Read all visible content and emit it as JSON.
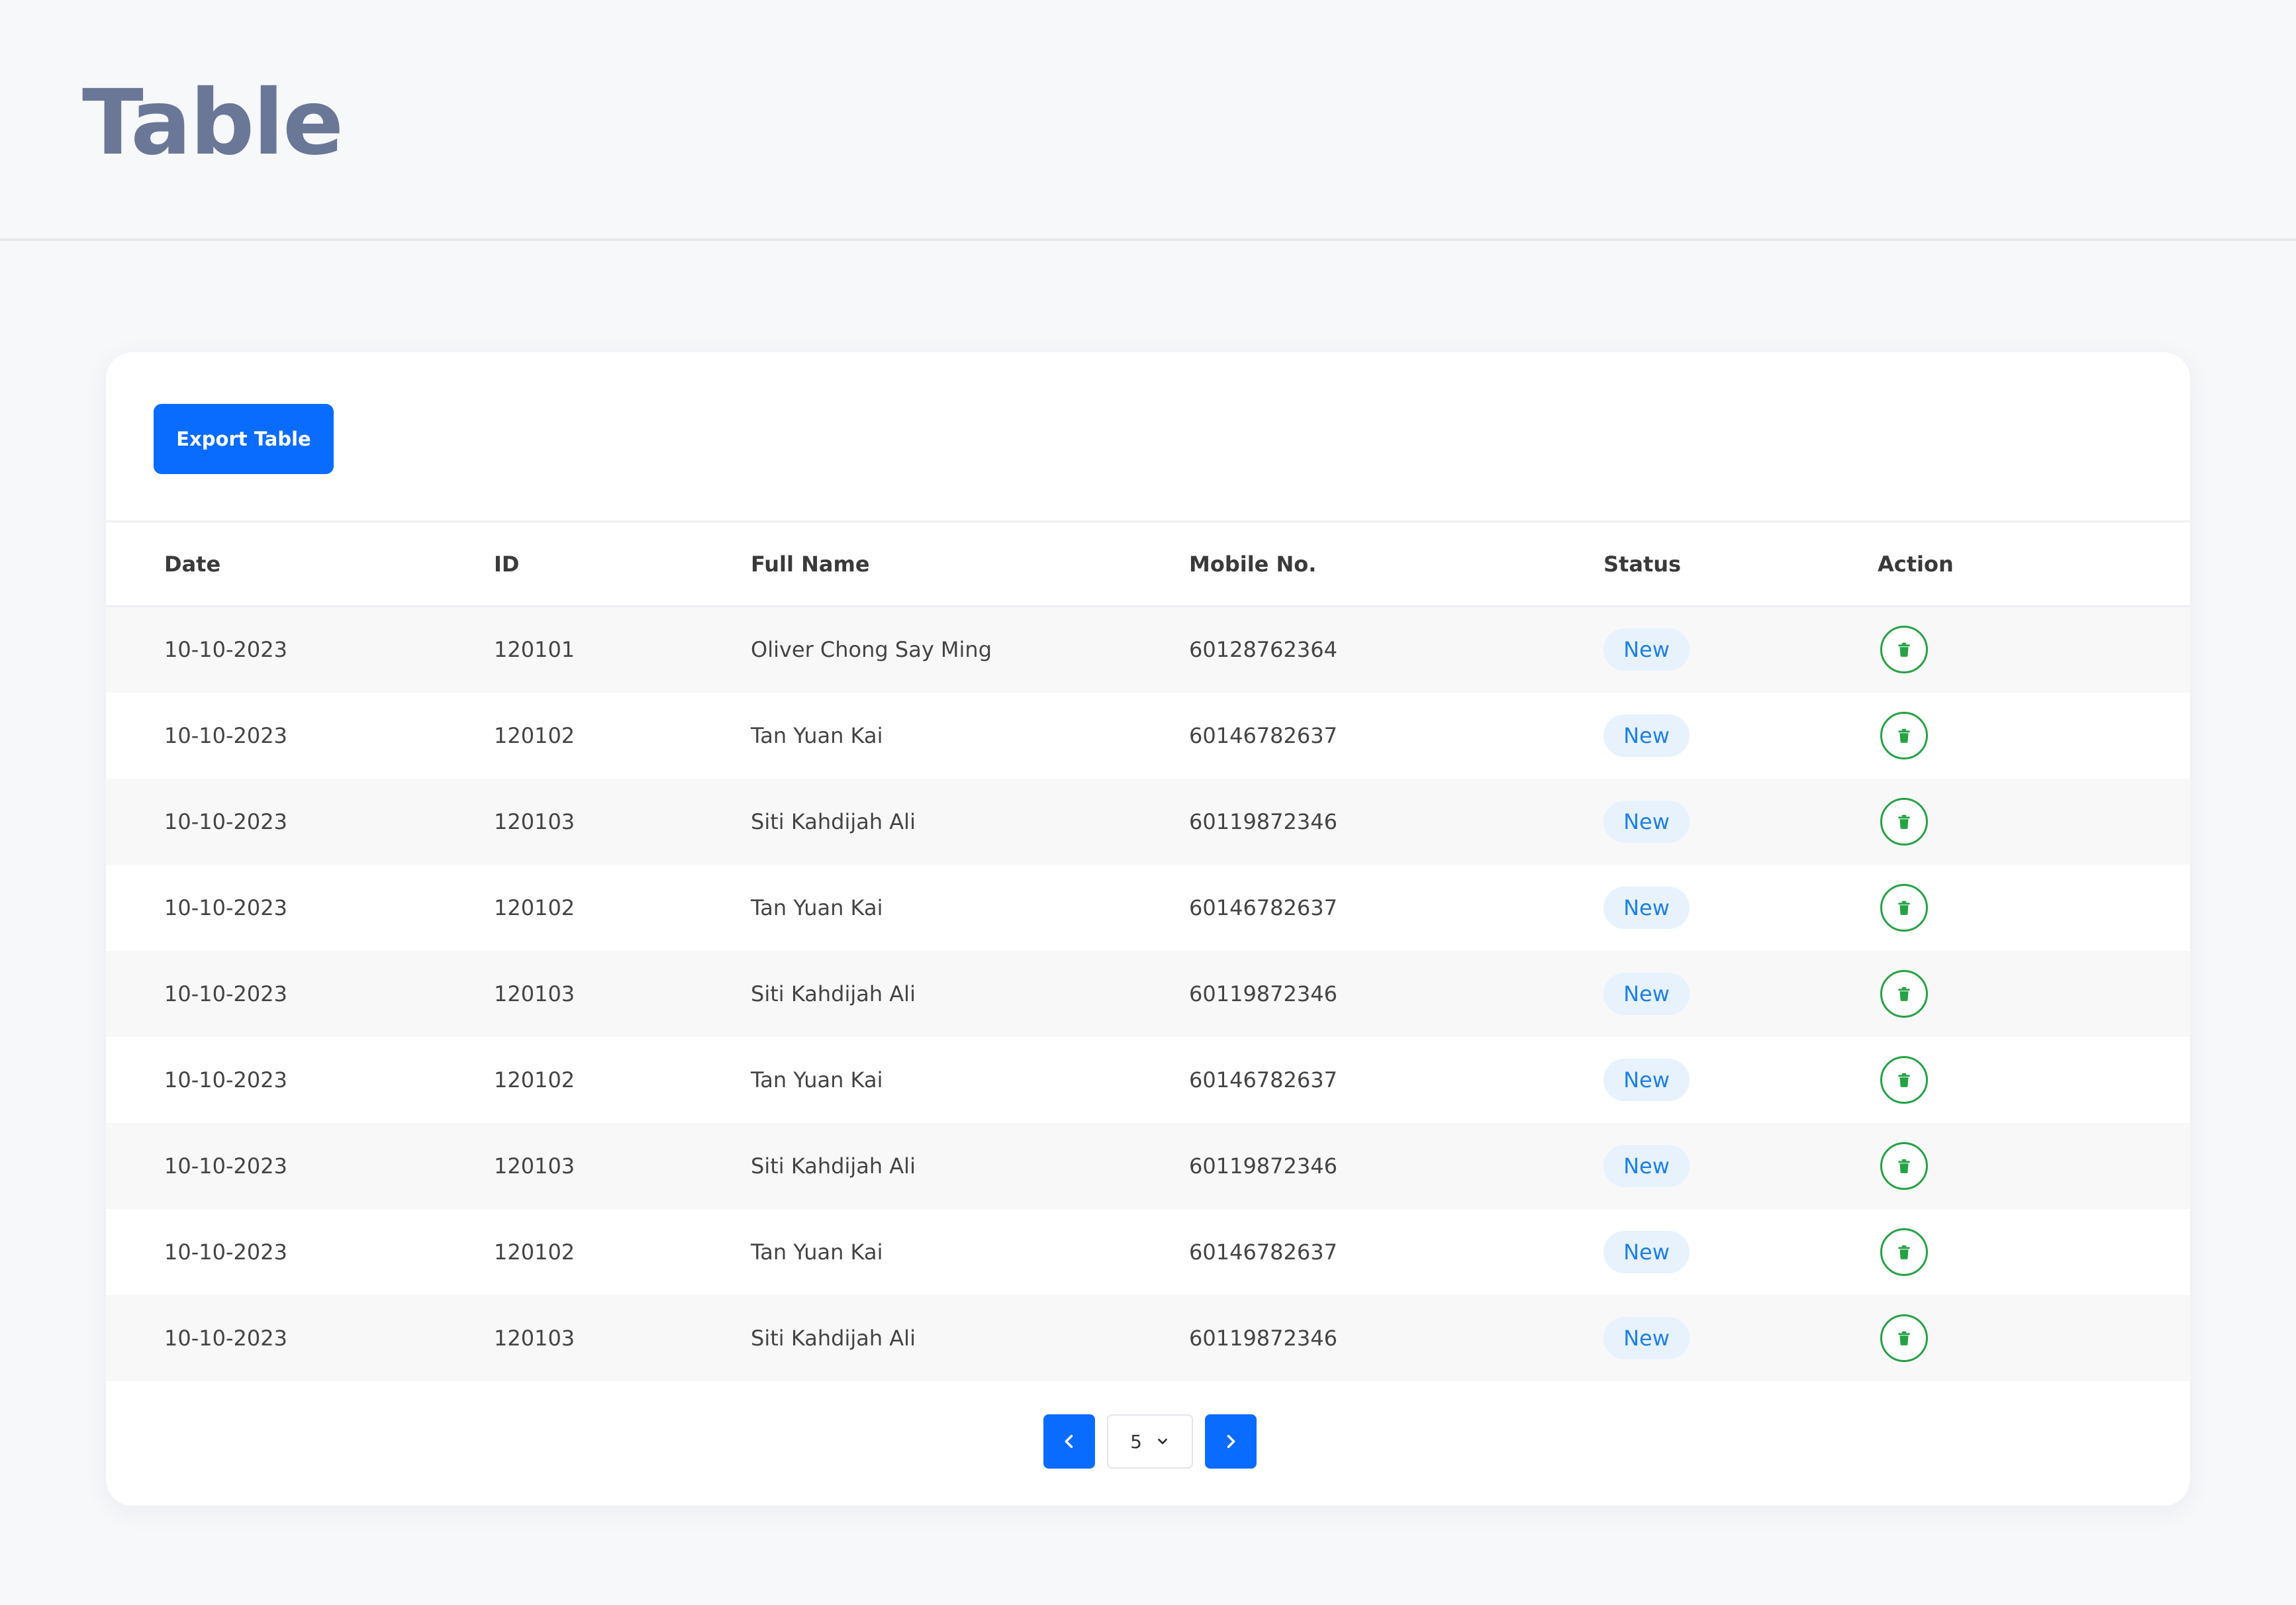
{
  "header": {
    "title": "Table"
  },
  "toolbar": {
    "export_label": "Export Table"
  },
  "table": {
    "columns": [
      "Date",
      "ID",
      "Full Name",
      "Mobile No.",
      "Status",
      "Action"
    ],
    "rows": [
      {
        "date": "10-10-2023",
        "id": "120101",
        "name": "Oliver Chong Say Ming",
        "mobile": "60128762364",
        "status": "New"
      },
      {
        "date": "10-10-2023",
        "id": "120102",
        "name": "Tan Yuan Kai",
        "mobile": "60146782637",
        "status": "New"
      },
      {
        "date": "10-10-2023",
        "id": "120103",
        "name": "Siti Kahdijah Ali",
        "mobile": "60119872346",
        "status": "New"
      },
      {
        "date": "10-10-2023",
        "id": "120102",
        "name": "Tan Yuan Kai",
        "mobile": "60146782637",
        "status": "New"
      },
      {
        "date": "10-10-2023",
        "id": "120103",
        "name": "Siti Kahdijah Ali",
        "mobile": "60119872346",
        "status": "New"
      },
      {
        "date": "10-10-2023",
        "id": "120102",
        "name": "Tan Yuan Kai",
        "mobile": "60146782637",
        "status": "New"
      },
      {
        "date": "10-10-2023",
        "id": "120103",
        "name": "Siti Kahdijah Ali",
        "mobile": "60119872346",
        "status": "New"
      },
      {
        "date": "10-10-2023",
        "id": "120102",
        "name": "Tan Yuan Kai",
        "mobile": "60146782637",
        "status": "New"
      },
      {
        "date": "10-10-2023",
        "id": "120103",
        "name": "Siti Kahdijah Ali",
        "mobile": "60119872346",
        "status": "New"
      }
    ]
  },
  "pagination": {
    "page_size": "5"
  },
  "icons": {
    "delete": "trash-icon",
    "prev": "chevron-left-icon",
    "next": "chevron-right-icon",
    "dropdown": "chevron-down-icon"
  },
  "colors": {
    "accent": "#0a6cff",
    "title": "#6b7797",
    "status_bg": "#e7f2fd",
    "status_text": "#1f7fe6",
    "delete_icon": "#25a244",
    "page_bg": "#f7f8fa"
  }
}
